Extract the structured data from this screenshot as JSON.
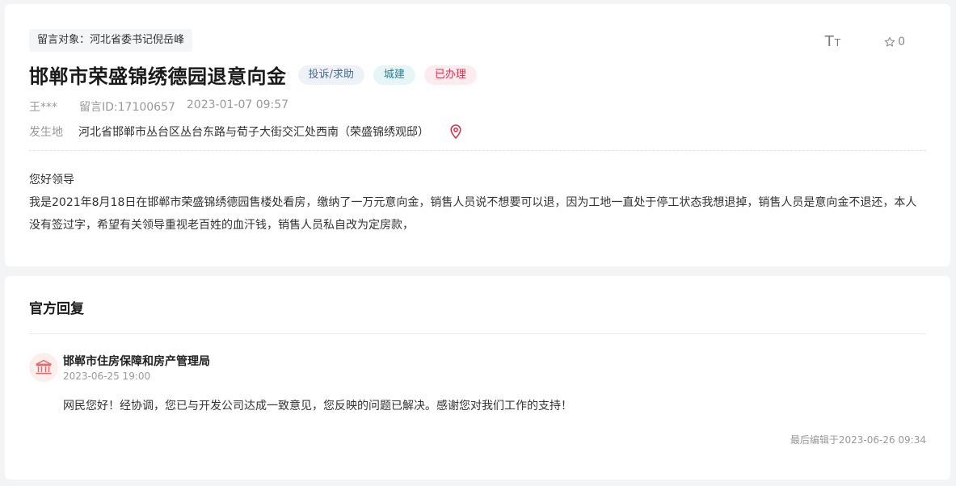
{
  "message": {
    "target": "留言对象：河北省委书记倪岳峰",
    "title": "邯郸市荣盛锦绣德园退意向金",
    "tags": {
      "type": "投诉/求助",
      "field": "城建",
      "status": "已办理"
    },
    "author": "王***",
    "message_id": "留言ID:17100657",
    "date": "2023-01-07 09:57",
    "location_label": "发生地",
    "location": "河北省邯郸市丛台区丛台东路与荀子大街交汇处西南（荣盛锦绣观邸）",
    "greeting": "您好领导",
    "body": "我是2021年8月18日在邯郸市荣盛锦绣德园售楼处看房，缴纳了一万元意向金，销售人员说不想要可以退，因为工地一直处于停工状态我想退掉，销售人员是意向金不退还，本人没有签过字，希望有关领导重视老百姓的血汗钱，销售人员私自改为定房款，"
  },
  "toolbar": {
    "font_size_icon": "font-size-icon",
    "font_size_big": "T",
    "font_size_small": "T",
    "favorite_icon": "star-outline-icon",
    "favorite_count": "0"
  },
  "reply": {
    "section_title": "官方回复",
    "org_icon": "government-building-icon",
    "org_name": "邯郸市住房保障和房产管理局",
    "time": "2023-06-25 19:00",
    "content": "网民您好！经协调，您已与开发公司达成一致意见，您反映的问题已解决。感谢您对我们工作的支持！",
    "last_edited": "最后编辑于2023-06-26 09:34"
  },
  "colors": {
    "page_background": "#f3f4f6",
    "status_red": "#d9334e",
    "location_pin": "#d9334e",
    "org_icon_red": "#e26b6b"
  }
}
